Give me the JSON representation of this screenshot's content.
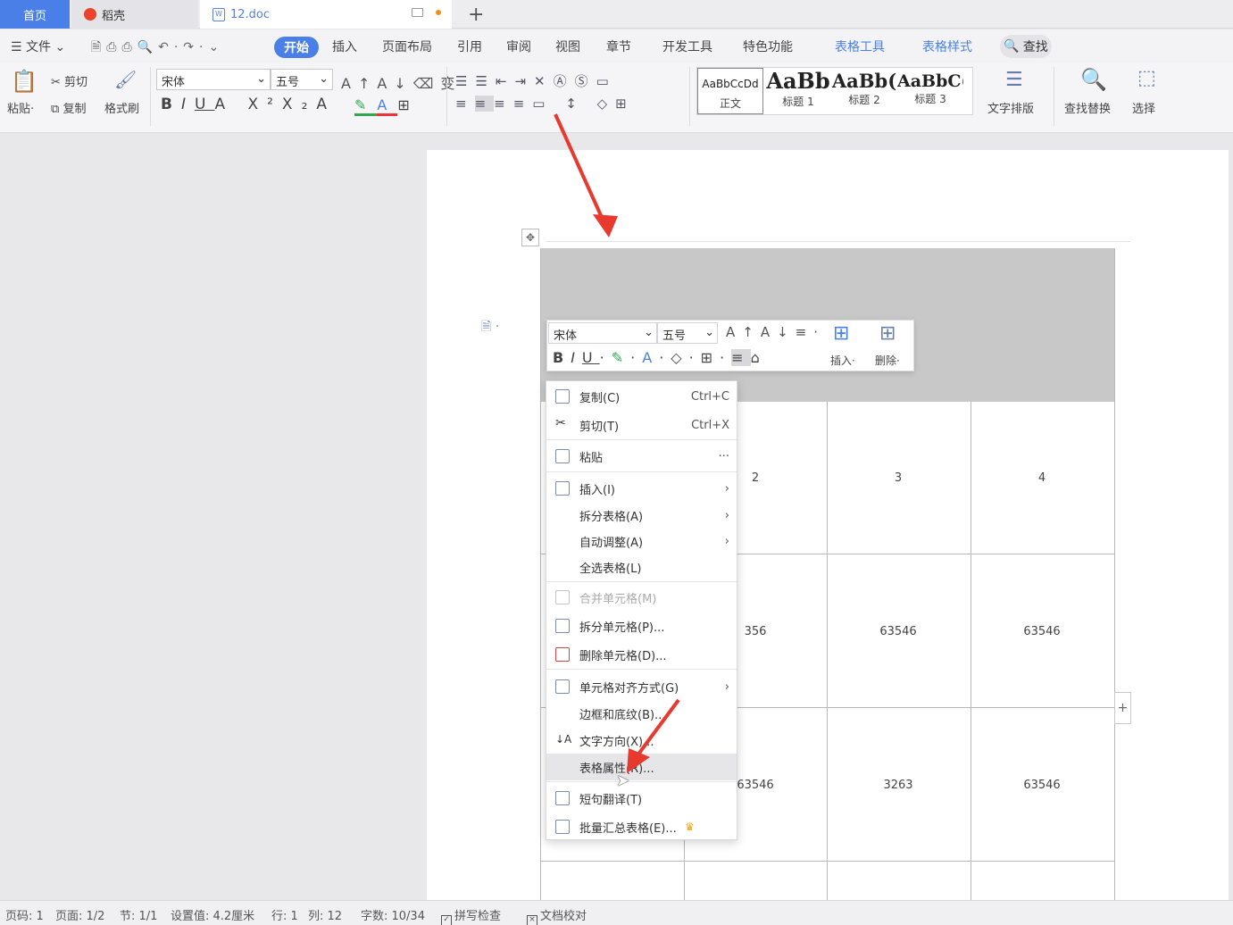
{
  "tabs": {
    "home": "首页",
    "daoke": "稻壳",
    "doc": "12.doc",
    "plus": "+"
  },
  "menubar": {
    "file": "文件",
    "items": [
      "开始",
      "插入",
      "页面布局",
      "引用",
      "审阅",
      "视图",
      "章节",
      "开发工具",
      "特色功能",
      "表格工具",
      "表格样式"
    ],
    "search": "查找"
  },
  "ribbon": {
    "paste": "粘贴",
    "cut": "剪切",
    "copy": "复制",
    "format_painter": "格式刷",
    "font": "宋体",
    "size": "五号",
    "styles": [
      {
        "preview": "AaBbCcDd",
        "label": "正文"
      },
      {
        "preview": "AaBb",
        "label": "标题 1"
      },
      {
        "preview": "AaBb(",
        "label": "标题 2"
      },
      {
        "preview": "AaBbC(",
        "label": "标题 3"
      }
    ],
    "text_layout": "文字排版",
    "find_replace": "查找替换",
    "select": "选择"
  },
  "mini_toolbar": {
    "font": "宋体",
    "size": "五号",
    "insert": "插入",
    "delete": "删除"
  },
  "table": {
    "row1": [
      "2",
      "3",
      "4"
    ],
    "row2": [
      "356",
      "63546",
      "63546"
    ],
    "row3": [
      "63546",
      "3263",
      "63546"
    ]
  },
  "context_menu": [
    {
      "label": "复制(C)",
      "shortcut": "Ctrl+C"
    },
    {
      "label": "剪切(T)",
      "shortcut": "Ctrl+X"
    },
    {
      "label": "粘贴",
      "shortcut": "···"
    },
    {
      "label": "插入(I)",
      "shortcut": "›"
    },
    {
      "label": "拆分表格(A)",
      "shortcut": "›"
    },
    {
      "label": "自动调整(A)",
      "shortcut": "›"
    },
    {
      "label": "全选表格(L)",
      "shortcut": ""
    },
    {
      "label": "合并单元格(M)",
      "shortcut": ""
    },
    {
      "label": "拆分单元格(P)...",
      "shortcut": ""
    },
    {
      "label": "删除单元格(D)...",
      "shortcut": ""
    },
    {
      "label": "单元格对齐方式(G)",
      "shortcut": "›"
    },
    {
      "label": "边框和底纹(B)...",
      "shortcut": ""
    },
    {
      "label": "文字方向(X)...",
      "shortcut": ""
    },
    {
      "label": "表格属性(R)...",
      "shortcut": ""
    },
    {
      "label": "短句翻译(T)",
      "shortcut": ""
    },
    {
      "label": "批量汇总表格(E)...",
      "shortcut": ""
    }
  ],
  "statusbar": {
    "page_no": "页码: 1",
    "pages": "页面: 1/2",
    "section": "节: 1/1",
    "setting": "设置值: 4.2厘米",
    "row": "行: 1",
    "col": "列: 12",
    "words": "字数: 10/34",
    "spell": "拼写检查",
    "proof": "文档校对"
  },
  "colors": {
    "accent": "#4a7fe8",
    "arrow": "#e8392e"
  }
}
